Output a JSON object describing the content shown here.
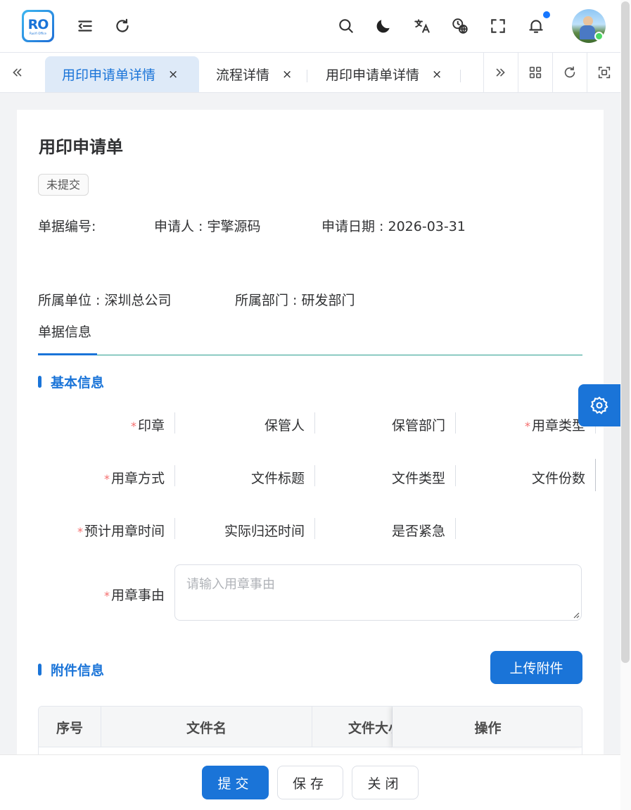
{
  "header": {
    "logo_text": "RO",
    "logo_sub": "RuoYi Office",
    "icons": [
      "menu-fold-icon",
      "refresh-icon",
      "search-icon",
      "moon-icon",
      "translate-icon",
      "globe-time-icon",
      "fullscreen-icon",
      "bell-icon"
    ],
    "notification_dot_color": "#1677ff"
  },
  "tabs": [
    {
      "label": "用印申请单详情",
      "active": true
    },
    {
      "label": "流程详情",
      "active": false
    },
    {
      "label": "用印申请单详情",
      "active": false
    }
  ],
  "tab_close": "×",
  "page": {
    "title": "用印申请单",
    "status": "未提交",
    "meta": {
      "doc_no": "单据编号:",
      "applicant": "申请人 : 宇擎源码",
      "apply_date": "申请日期 : 2026-03-31",
      "unit": "所属单位 : 深圳总公司",
      "dept": "所属部门 : 研发部门"
    },
    "inner_tab": "单据信息"
  },
  "basic_section": "基本信息",
  "fields": {
    "seal": "印章",
    "keeper": "保管人",
    "keeper_dept": "保管部门",
    "seal_type": "用章类型",
    "seal_method": "用章方式",
    "file_title": "文件标题",
    "file_type": "文件类型",
    "file_copies": "文件份数",
    "planned_time": "预计用章时间",
    "actual_return": "实际归还时间",
    "urgent": "是否紧急",
    "reason": "用章事由",
    "reason_placeholder": "请输入用章事由"
  },
  "required_mark": "*",
  "attachments": {
    "section": "附件信息",
    "upload": "上传附件",
    "columns": [
      "序号",
      "文件名",
      "文件大小",
      "操作"
    ]
  },
  "footer": {
    "submit": "提交",
    "save": "保存",
    "close": "关闭"
  },
  "colors": {
    "primary": "#1a74d8",
    "required": "#f56c6c",
    "active_tab_bg": "#deeaf8"
  }
}
